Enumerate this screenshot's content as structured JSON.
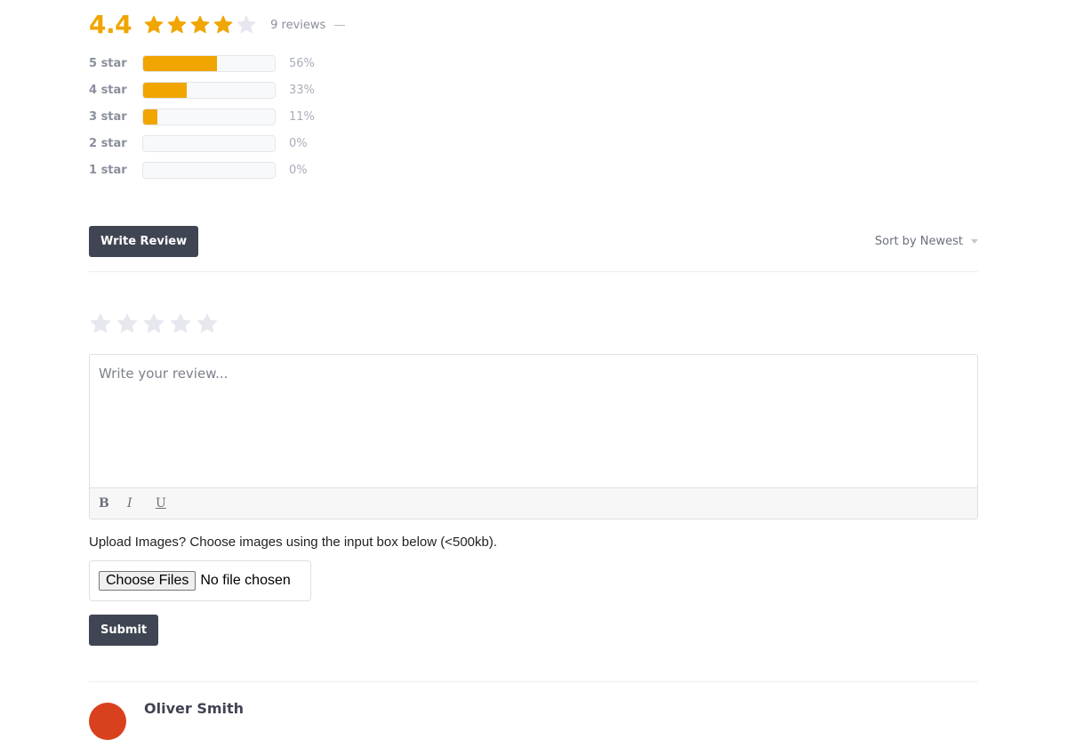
{
  "summary": {
    "average": "4.4",
    "rating_value": 4.4,
    "stars": [
      {
        "filled": true
      },
      {
        "filled": true
      },
      {
        "filled": true
      },
      {
        "filled": true
      },
      {
        "filled": false
      }
    ],
    "reviews_count": "9 reviews"
  },
  "distribution": [
    {
      "label": "5 star",
      "percent_text": "56%",
      "percent": 56
    },
    {
      "label": "4 star",
      "percent_text": "33%",
      "percent": 33
    },
    {
      "label": "3 star",
      "percent_text": "11%",
      "percent": 11
    },
    {
      "label": "2 star",
      "percent_text": "0%",
      "percent": 0
    },
    {
      "label": "1 star",
      "percent_text": "0%",
      "percent": 0
    }
  ],
  "actions": {
    "write_review_label": "Write Review",
    "sort_label": "Sort by Newest"
  },
  "form": {
    "rating_selected": 0,
    "review_placeholder": "Write your review...",
    "review_value": "",
    "toolbar": {
      "bold": "B",
      "italic": "I",
      "underline": "U"
    },
    "upload_text": "Upload Images? Choose images using the input box below (<500kb).",
    "choose_files_label": "Choose Files",
    "file_status": "No file chosen",
    "submit_label": "Submit"
  },
  "reviews": [
    {
      "name": "Oliver Smith"
    }
  ],
  "colors": {
    "accent": "#f0a500",
    "star_empty": "#e6e7ef",
    "button_dark": "#404553",
    "avatar": "#d9411e"
  }
}
